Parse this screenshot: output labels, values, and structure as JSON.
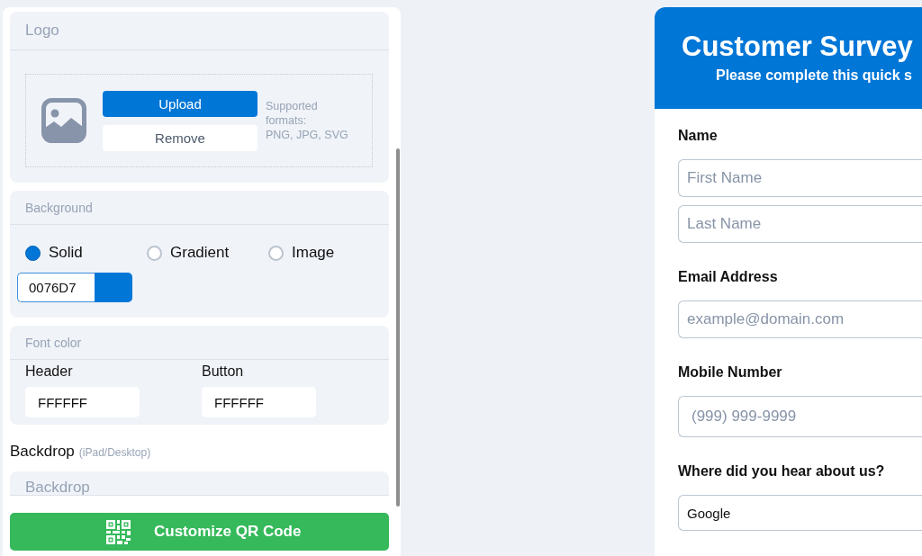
{
  "settings_panel": {
    "logo": {
      "title": "Logo",
      "buttons": [
        {
          "label": "Upload",
          "kind": "primary"
        },
        {
          "label": "Remove",
          "kind": "secondary"
        }
      ],
      "hint": "Supported formats:\nPNG, JPG, SVG"
    },
    "background": {
      "title": "Background",
      "options": [
        {
          "label": "Solid",
          "selected": true
        },
        {
          "label": "Gradient",
          "selected": false
        },
        {
          "label": "Image",
          "selected": false
        }
      ],
      "color_value": "0076D7"
    },
    "font_color": {
      "title": "Font color",
      "fields": [
        {
          "label": "Header",
          "value": "FFFFFF"
        },
        {
          "label": "Button",
          "value": "FFFFFF"
        }
      ]
    },
    "backdrop": {
      "heading": "Backdrop",
      "note": "(iPad/Desktop)",
      "section_title": "Backdrop"
    },
    "action_button": {
      "label": "Customize QR Code"
    }
  },
  "preview": {
    "title": "Customer Survey",
    "subtitle": "Please complete this quick s",
    "fields": [
      {
        "label": "Name",
        "inputs": [
          {
            "kind": "text",
            "placeholder": "First Name"
          },
          {
            "kind": "text",
            "placeholder": "Last Name"
          }
        ]
      },
      {
        "label": "Email Address",
        "inputs": [
          {
            "kind": "text",
            "placeholder": "example@domain.com"
          }
        ]
      },
      {
        "label": "Mobile Number",
        "inputs": [
          {
            "kind": "tel",
            "placeholder": "(999) 999-9999"
          }
        ]
      },
      {
        "label": "Where did you hear about us?",
        "inputs": [
          {
            "kind": "select",
            "value": "Google"
          }
        ]
      }
    ]
  }
}
